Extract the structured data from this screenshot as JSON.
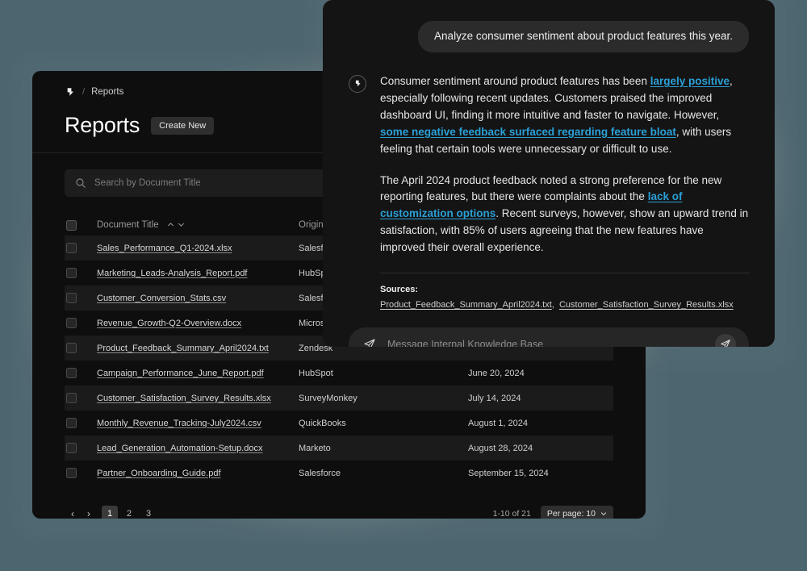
{
  "theme": {
    "page_background": "#4c6670",
    "panel_background": "#0e0e0e",
    "chat_background": "#141414",
    "accent_link": "#2a9fd6",
    "row_alt": "#1b1b1b"
  },
  "reports_window": {
    "breadcrumb": {
      "logo_icon": "app-logo-icon",
      "separator": "/",
      "current": "Reports"
    },
    "page_title": "Reports",
    "create_new_label": "Create New",
    "search": {
      "icon": "search-icon",
      "placeholder": "Search by Document Title"
    },
    "table": {
      "columns": [
        {
          "key": "title",
          "label": "Document Title",
          "sortable": true
        },
        {
          "key": "origin",
          "label": "Origin",
          "sortable": true
        },
        {
          "key": "date",
          "label": "",
          "sortable": false
        }
      ],
      "rows": [
        {
          "title": "Sales_Performance_Q1-2024.xlsx",
          "origin": "Salesforce",
          "date": ""
        },
        {
          "title": "Marketing_Leads-Analysis_Report.pdf",
          "origin": "HubSpot",
          "date": ""
        },
        {
          "title": "Customer_Conversion_Stats.csv",
          "origin": "Salesforce",
          "date": ""
        },
        {
          "title": "Revenue_Growth-Q2-Overview.docx",
          "origin": "Microsoft Dynamic",
          "date": ""
        },
        {
          "title": "Product_Feedback_Summary_April2024.txt",
          "origin": "Zendesk",
          "date": ""
        },
        {
          "title": "Campaign_Performance_June_Report.pdf",
          "origin": "HubSpot",
          "date": "June 20, 2024"
        },
        {
          "title": "Customer_Satisfaction_Survey_Results.xlsx",
          "origin": "SurveyMonkey",
          "date": "July 14, 2024"
        },
        {
          "title": "Monthly_Revenue_Tracking-July2024.csv",
          "origin": "QuickBooks",
          "date": "August 1, 2024"
        },
        {
          "title": "Lead_Generation_Automation-Setup.docx",
          "origin": "Marketo",
          "date": "August 28, 2024"
        },
        {
          "title": "Partner_Onboarding_Guide.pdf",
          "origin": "Salesforce",
          "date": "September 15, 2024"
        }
      ]
    },
    "pagination": {
      "prev_icon": "chevron-left-icon",
      "next_icon": "chevron-right-icon",
      "pages": [
        "1",
        "2",
        "3"
      ],
      "active_page": "1",
      "range_label": "1-10 of 21",
      "per_page_label": "Per page: 10"
    }
  },
  "chat_panel": {
    "user_message": "Analyze consumer sentiment about product features this year.",
    "assistant_avatar_icon": "app-logo-icon",
    "assistant_response": {
      "paragraph_1": {
        "segment_1": "Consumer sentiment around product features has been ",
        "link_1": "largely positive",
        "segment_2": ", especially following recent updates. Customers praised the improved dashboard UI, finding it more intuitive and faster to navigate. However, ",
        "link_2": "some negative feedback surfaced regarding feature bloat",
        "segment_3": ", with users feeling that certain tools were unnecessary or difficult to use."
      },
      "paragraph_2": {
        "segment_1": "The April 2024 product feedback noted a strong preference for the new reporting features, but there were complaints about the ",
        "link_1": "lack of customization options",
        "segment_2": ". Recent surveys, however, show an upward trend in satisfaction, with 85% of users agreeing that the new features have improved their overall experience."
      }
    },
    "sources": {
      "label": "Sources:",
      "items": [
        "Product_Feedback_Summary_April2024.txt",
        "Customer_Satisfaction_Survey_Results.xlsx"
      ],
      "separator": ","
    },
    "composer": {
      "left_icon": "send-icon",
      "placeholder": "Message Internal Knowledge Base",
      "send_icon": "send-icon"
    }
  }
}
